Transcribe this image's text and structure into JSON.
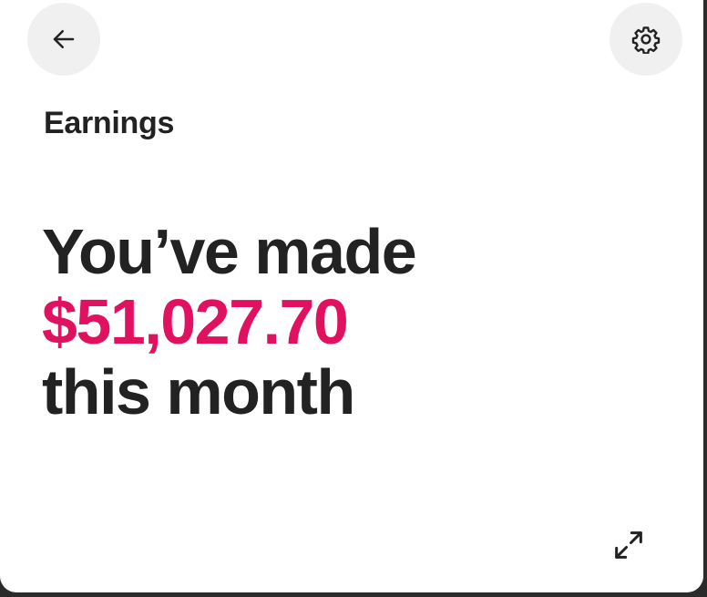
{
  "header": {
    "back_icon": "arrow-left-icon",
    "settings_icon": "gear-icon"
  },
  "section": {
    "title": "Earnings"
  },
  "summary": {
    "line1": "You’ve made",
    "amount": "$51,027.70",
    "line3": "this month",
    "amount_color": "#e0115f"
  },
  "footer": {
    "expand_icon": "expand-icon"
  }
}
